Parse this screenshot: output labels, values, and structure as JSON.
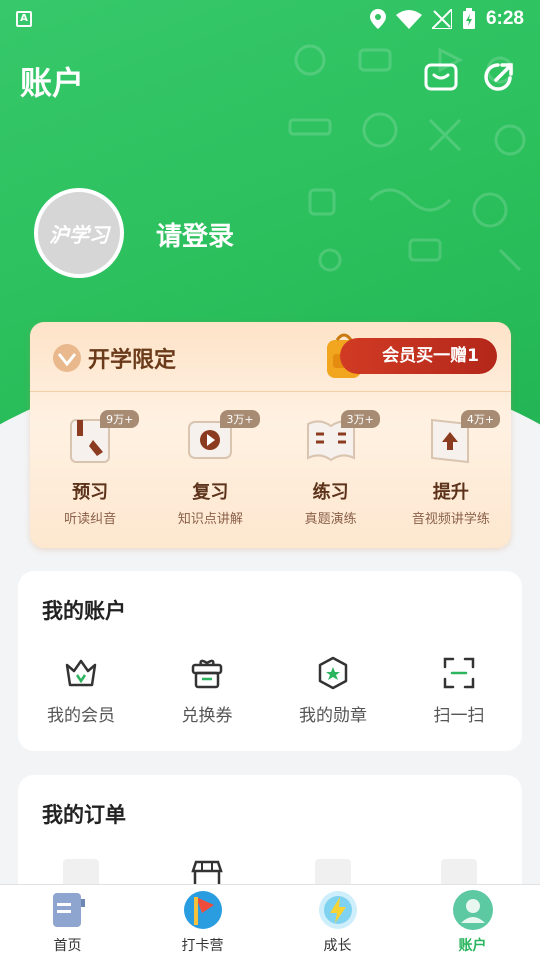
{
  "status_bar": {
    "time": "6:28",
    "app_icon": "A"
  },
  "header": {
    "title": "账户"
  },
  "user": {
    "avatar_text": "沪学习",
    "login_prompt": "请登录"
  },
  "promo": {
    "title": "开学限定",
    "badge": "会员买一赠1",
    "items": [
      {
        "name": "预习",
        "sub": "听读纠音",
        "count": "9万+"
      },
      {
        "name": "复习",
        "sub": "知识点讲解",
        "count": "3万+"
      },
      {
        "name": "练习",
        "sub": "真题演练",
        "count": "3万+"
      },
      {
        "name": "提升",
        "sub": "音视频讲学练",
        "count": "4万+"
      }
    ]
  },
  "account": {
    "title": "我的账户",
    "items": [
      {
        "label": "我的会员"
      },
      {
        "label": "兑换券"
      },
      {
        "label": "我的勋章"
      },
      {
        "label": "扫一扫"
      }
    ]
  },
  "orders": {
    "title": "我的订单"
  },
  "tabbar": {
    "items": [
      {
        "label": "首页"
      },
      {
        "label": "打卡营"
      },
      {
        "label": "成长"
      },
      {
        "label": "账户"
      }
    ],
    "active_color": "#2bb55e"
  },
  "colors": {
    "brand_green": "#2bbf5c",
    "promo_red": "#c8321f"
  }
}
